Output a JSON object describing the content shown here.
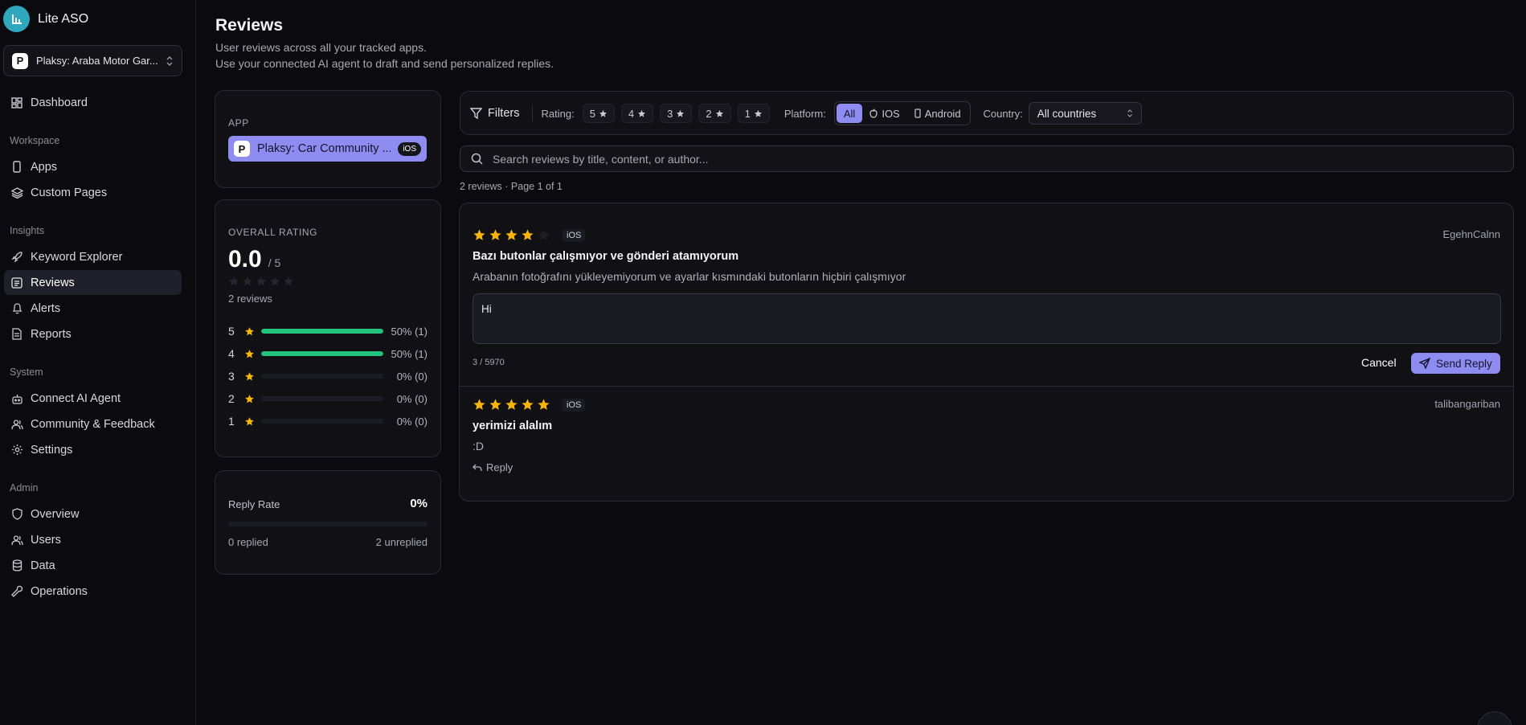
{
  "sidebar": {
    "brand": "Lite ASO",
    "app_switcher": {
      "name": "Plaksy: Araba Motor Gar...",
      "icon": "P"
    },
    "items": [
      {
        "label": "Dashboard",
        "icon": "grid-icon"
      },
      {
        "label": "Apps",
        "icon": "phone-icon"
      },
      {
        "label": "Custom Pages",
        "icon": "layers-icon"
      },
      {
        "label": "Keyword Explorer",
        "icon": "rocket-icon"
      },
      {
        "label": "Reviews",
        "icon": "message-square-icon"
      },
      {
        "label": "Alerts",
        "icon": "bell-icon"
      },
      {
        "label": "Reports",
        "icon": "file-icon"
      },
      {
        "label": "Connect AI Agent",
        "icon": "bot-icon"
      },
      {
        "label": "Community & Feedback",
        "icon": "users-icon"
      },
      {
        "label": "Settings",
        "icon": "gear-icon"
      },
      {
        "label": "Overview",
        "icon": "shield-icon"
      },
      {
        "label": "Users",
        "icon": "users-icon"
      },
      {
        "label": "Data",
        "icon": "database-icon"
      },
      {
        "label": "Operations",
        "icon": "wrench-icon"
      }
    ],
    "sections": [
      "Workspace",
      "Insights",
      "System",
      "Admin"
    ]
  },
  "page": {
    "title": "Reviews",
    "subtitle_1": "User reviews across all your tracked apps.",
    "subtitle_2": "Use your connected AI agent to draft and send personalized replies."
  },
  "app_card": {
    "label": "APP",
    "app_name": "Plaksy: Car Community ...",
    "app_icon": "P",
    "platform_badge": "iOS"
  },
  "rating_card": {
    "label": "OVERALL RATING",
    "value": "0.0",
    "denominator": "/ 5",
    "count_text": "2 reviews",
    "distribution": [
      {
        "stars": "5",
        "pct_text": "50% (1)",
        "fraction": 1.0
      },
      {
        "stars": "4",
        "pct_text": "50% (1)",
        "fraction": 1.0
      },
      {
        "stars": "3",
        "pct_text": "0% (0)",
        "fraction": 0
      },
      {
        "stars": "2",
        "pct_text": "0% (0)",
        "fraction": 0
      },
      {
        "stars": "1",
        "pct_text": "0% (0)",
        "fraction": 0
      }
    ]
  },
  "reply_card": {
    "label": "Reply Rate",
    "value": "0%",
    "fraction": 0,
    "replied": "0 replied",
    "unreplied": "2 unreplied"
  },
  "filters": {
    "label": "Filters",
    "rating_label": "Rating:",
    "ratings": [
      "5",
      "4",
      "3",
      "2",
      "1"
    ],
    "platform_label": "Platform:",
    "platforms": [
      "All",
      "IOS",
      "Android"
    ],
    "platform_selected": "All",
    "country_label": "Country:",
    "country_value": "All countries"
  },
  "search": {
    "placeholder": "Search reviews by title, content, or author..."
  },
  "results_text": "2 reviews · Page 1 of 1",
  "reviews": [
    {
      "rating": 4,
      "platform": "iOS",
      "author": "EgehnCalnn",
      "title": "Bazı butonlar çalışmıyor ve gönderi atamıyorum",
      "body": "Arabanın fotoğrafını yükleyemiyorum ve ayarlar kısmındaki butonların hiçbiri çalışmıyor",
      "reply_draft": "Hi",
      "char_count": "3 / 5970",
      "cancel_label": "Cancel",
      "send_label": "Send Reply"
    },
    {
      "rating": 5,
      "platform": "iOS",
      "author": "talibangariban",
      "title": "yerimizi alalım",
      "body": ":D",
      "reply_label": "Reply"
    }
  ],
  "colors": {
    "accent": "#8e8cf0",
    "star": "#f5b50a",
    "bar": "#22c37a",
    "brand": "#2fa8bd"
  }
}
